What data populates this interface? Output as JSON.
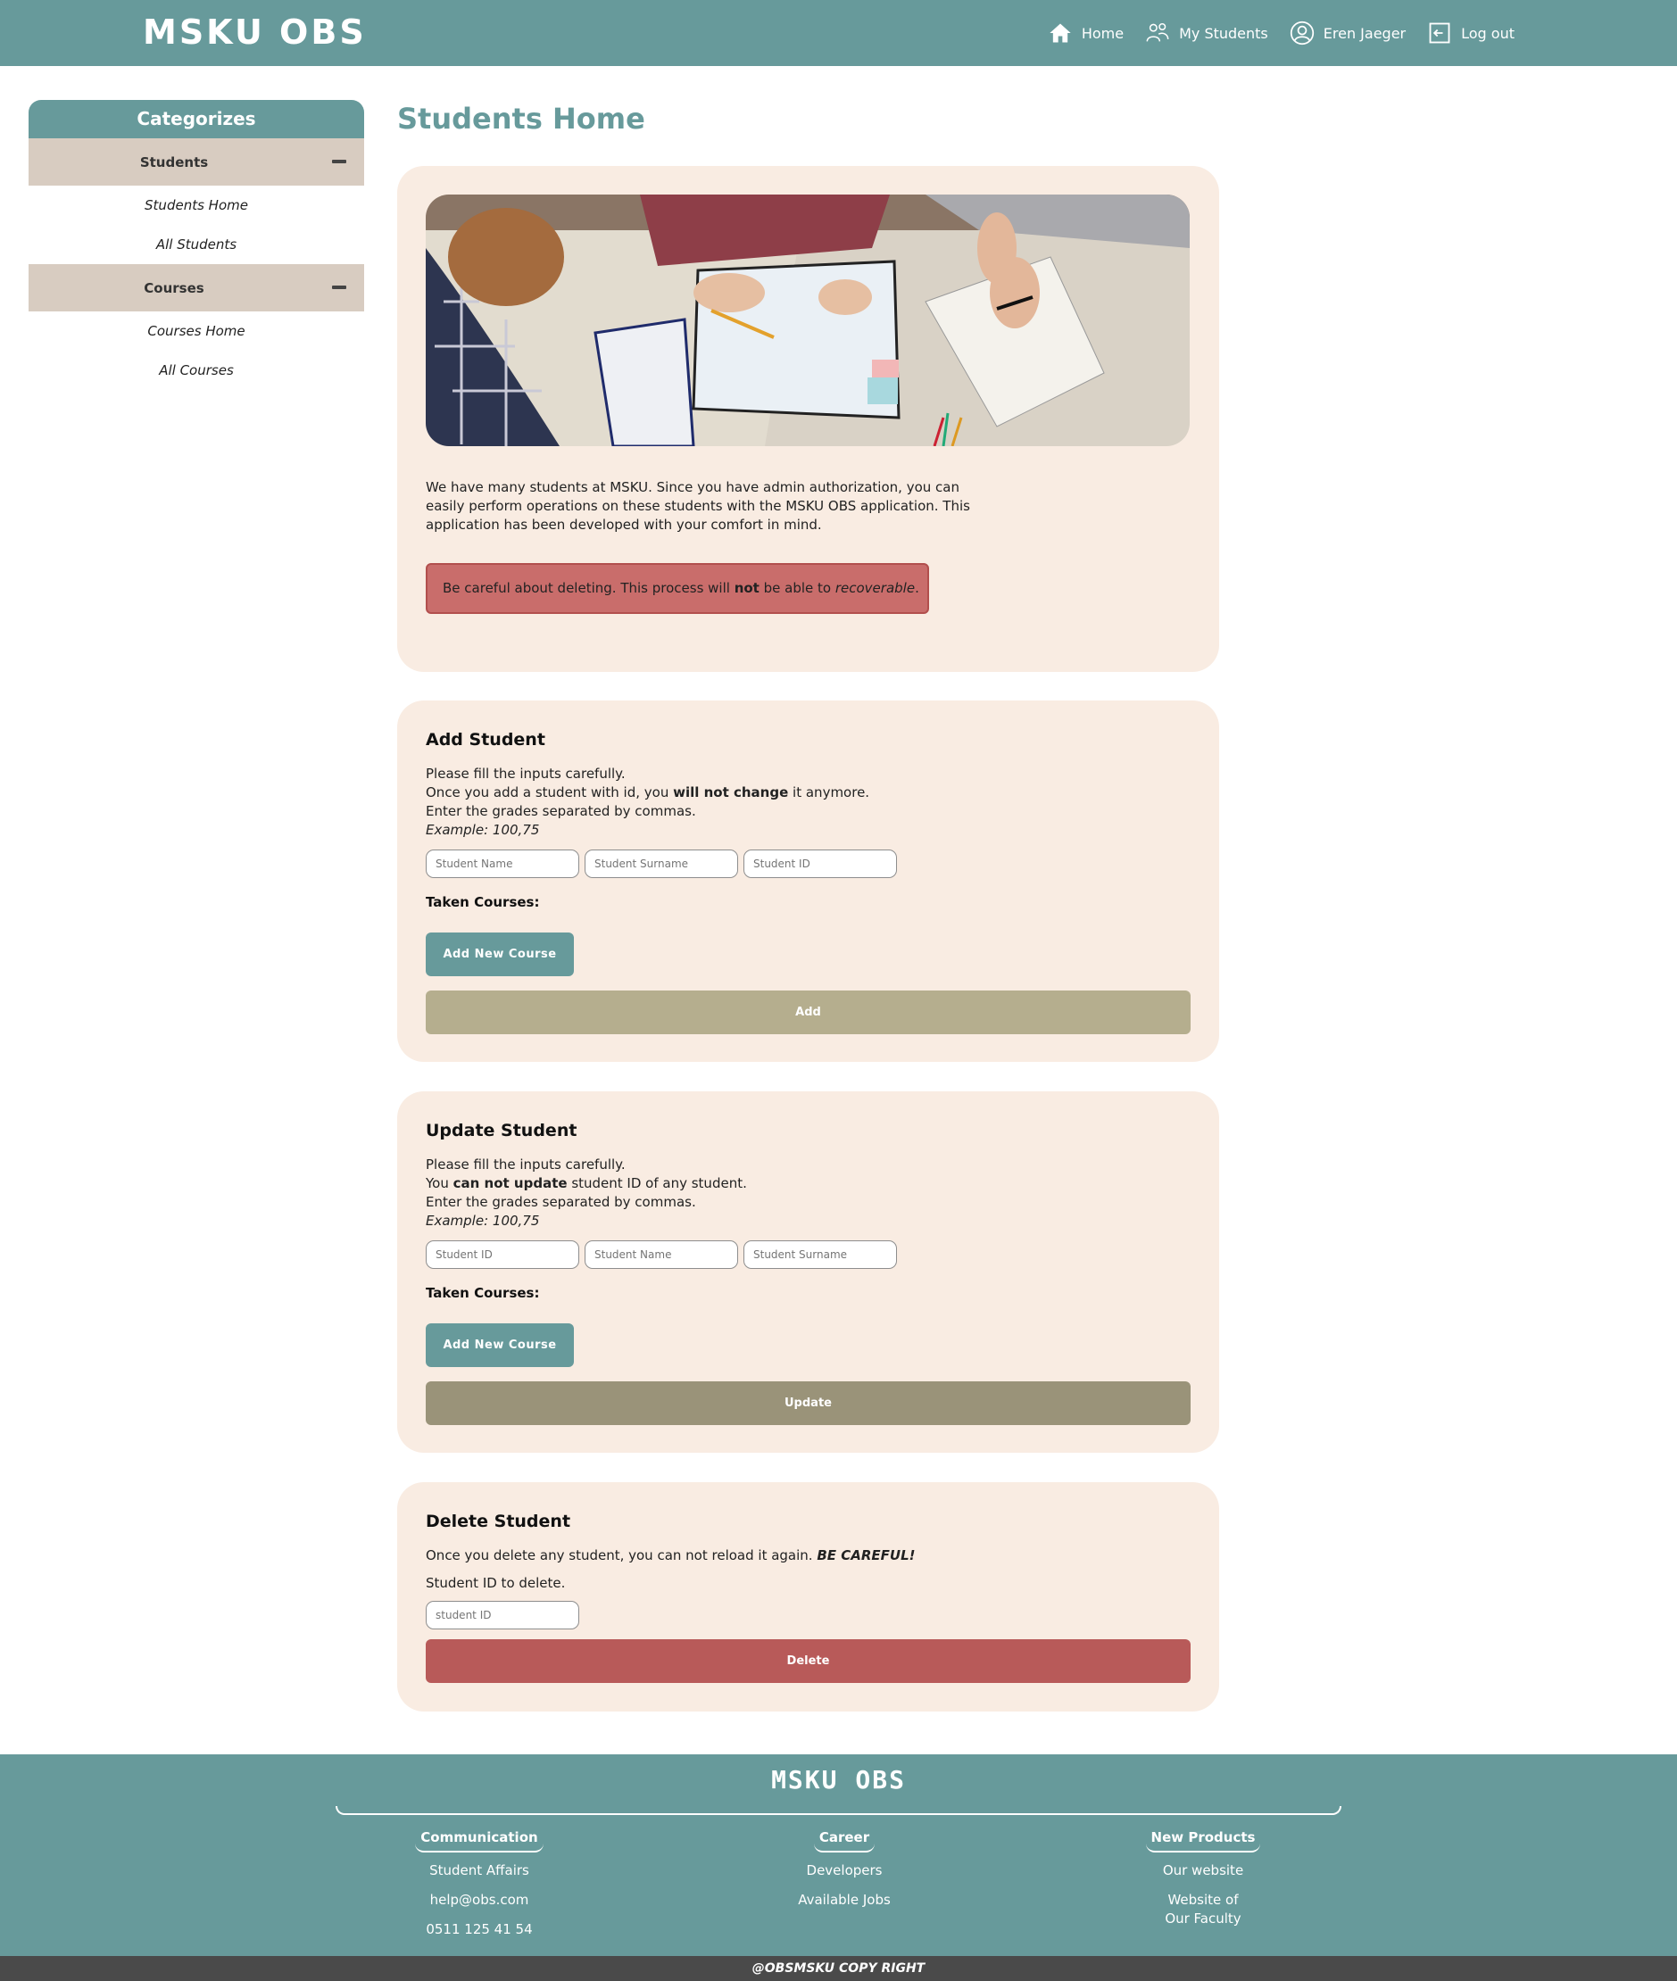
{
  "header": {
    "brand": "MSKU OBS",
    "nav": {
      "home": "Home",
      "my_students": "My Students",
      "user": "Eren Jaeger",
      "logout": "Log out"
    }
  },
  "sidebar": {
    "title": "Categorizes",
    "groups": [
      {
        "label": "Students",
        "links": [
          "Students Home",
          "All Students"
        ]
      },
      {
        "label": "Courses",
        "links": [
          "Courses Home",
          "All Courses"
        ]
      }
    ]
  },
  "main": {
    "page_title": "Students Home",
    "intro": {
      "text": "We have many students at MSKU. Since you have admin authorization, you can easily perform operations on these students with the MSKU OBS application. This application has been developed with your comfort in mind.",
      "warning_pre": "Be careful about deleting. This process will ",
      "warning_bold": "not",
      "warning_mid": " be able to ",
      "warning_italic": "recoverable",
      "warning_end": "."
    },
    "add_student": {
      "title": "Add Student",
      "line1": "Please fill the inputs carefully.",
      "line2_pre": "Once you add a student with id, you ",
      "line2_bold": "will not change",
      "line2_post": " it anymore.",
      "line3": "Enter the grades separated by commas.",
      "example": "Example: 100,75",
      "placeholders": [
        "Student Name",
        "Student Surname",
        "Student ID"
      ],
      "taken_label": "Taken Courses:",
      "add_course_label": "Add New Course",
      "submit_label": "Add"
    },
    "update_student": {
      "title": "Update Student",
      "line1": "Please fill the inputs carefully.",
      "line2_pre": "You ",
      "line2_bold": "can not update",
      "line2_post": " student ID of any student.",
      "line3": "Enter the grades separated by commas.",
      "example": "Example: 100,75",
      "placeholders": [
        "Student ID",
        "Student Name",
        "Student Surname"
      ],
      "taken_label": "Taken Courses:",
      "add_course_label": "Add New Course",
      "submit_label": "Update"
    },
    "delete_student": {
      "title": "Delete Student",
      "line1_pre": "Once you delete any student, you can not reload it again. ",
      "line1_bold": "BE CAREFUL!",
      "line2": "Student ID to delete.",
      "placeholder": "student ID",
      "submit_label": "Delete"
    }
  },
  "footer": {
    "logo": "MSKU OBS",
    "columns": [
      {
        "title": "Communication",
        "links": [
          "Student Affairs",
          "help@obs.com",
          "0511 125 41 54"
        ]
      },
      {
        "title": "Career",
        "links": [
          "Developers",
          "Available Jobs"
        ]
      },
      {
        "title": "New Products",
        "links": [
          "Our website",
          "Website of Our Faculty"
        ]
      }
    ],
    "copyright": "@OBSMSKU COPY RIGHT"
  },
  "colors": {
    "primary": "#679a9b",
    "card_bg": "#f9ece2",
    "sidebar_category": "#d8ccc1",
    "add_button": "#b5ae8e",
    "update_button": "#9a9379",
    "delete_button": "#b85a59",
    "warning_bg": "#c96d6b",
    "copyright_bar": "#4a4a4a"
  },
  "icons": [
    "home-icon",
    "users-icon",
    "user-icon",
    "logout-icon",
    "minus-icon"
  ]
}
